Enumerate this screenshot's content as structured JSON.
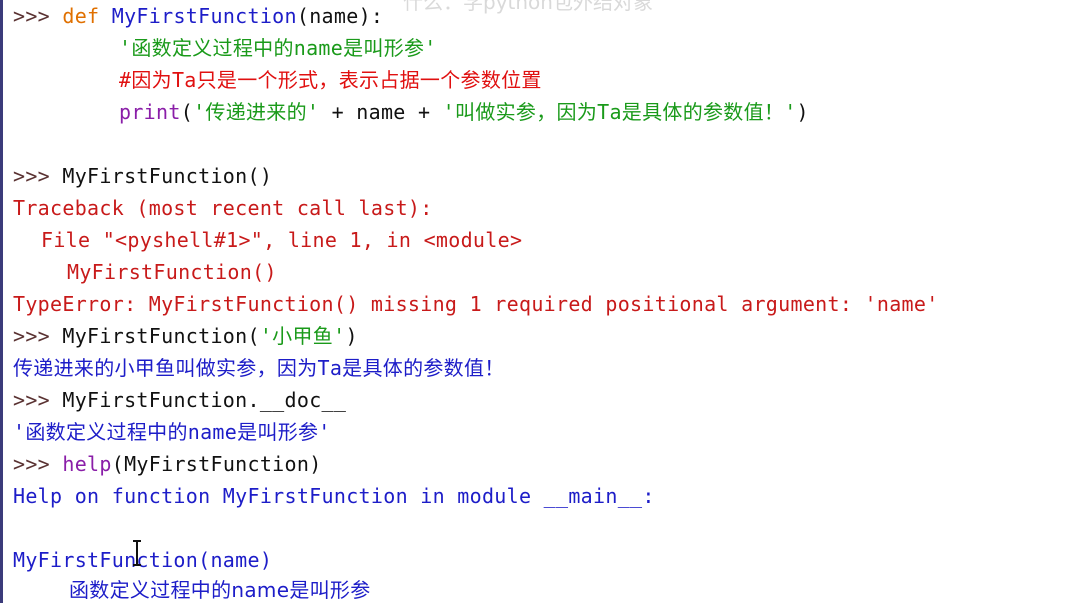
{
  "watermark": "什么：学python包外结对象",
  "lines": {
    "l1": {
      "prompt": ">>> ",
      "kw": "def ",
      "fn": "MyFirstFunction",
      "rest": "(name):"
    },
    "l2": {
      "str": "'函数定义过程中的name是叫形参'"
    },
    "l3": {
      "comment": "#因为Ta只是一个形式，表示占据一个参数位置"
    },
    "l4": {
      "builtin": "print",
      "p1": "(",
      "s1": "'传递进来的'",
      "mid": " + name + ",
      "s2": "'叫做实参，因为Ta是具体的参数值！'",
      "p2": ")"
    },
    "l5": {
      "prompt": ">>> ",
      "code": "MyFirstFunction()"
    },
    "l6": {
      "text": "Traceback (most recent call last):"
    },
    "l7": {
      "text": "File \"<pyshell#1>\", line 1, in <module>"
    },
    "l8": {
      "text": "MyFirstFunction()"
    },
    "l9": {
      "text": "TypeError: MyFirstFunction() missing 1 required positional argument: 'name'"
    },
    "l10": {
      "prompt": ">>> ",
      "code": "MyFirstFunction(",
      "str": "'小甲鱼'",
      "end": ")"
    },
    "l11": {
      "text": "传递进来的小甲鱼叫做实参，因为Ta是具体的参数值！"
    },
    "l12": {
      "prompt": ">>> ",
      "code": "MyFirstFunction.__doc__"
    },
    "l13": {
      "text": "'函数定义过程中的name是叫形参'"
    },
    "l14": {
      "prompt": ">>> ",
      "builtin": "help",
      "code": "(MyFirstFunction)"
    },
    "l15": {
      "text": "Help on function MyFirstFunction in module __main__:"
    },
    "l16": {
      "text": "MyFirstFunction(name)"
    },
    "l17": {
      "text": "函数定义过程中的name是叫形参"
    }
  }
}
